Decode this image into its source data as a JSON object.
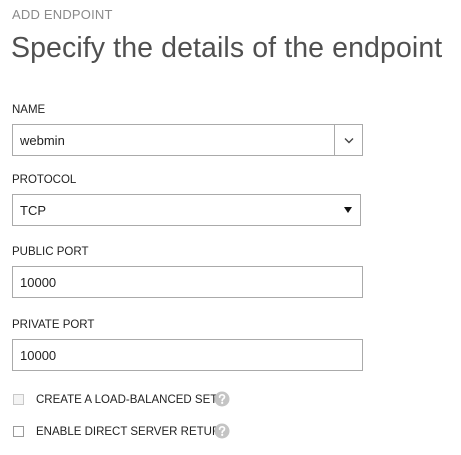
{
  "header": {
    "subtitle": "ADD ENDPOINT",
    "title": "Specify the details of the endpoint"
  },
  "form": {
    "name": {
      "label": "NAME",
      "value": "webmin"
    },
    "protocol": {
      "label": "PROTOCOL",
      "value": "TCP"
    },
    "public_port": {
      "label": "PUBLIC PORT",
      "value": "10000"
    },
    "private_port": {
      "label": "PRIVATE PORT",
      "value": "10000"
    },
    "load_balanced": {
      "label": "CREATE A LOAD-BALANCED SET",
      "checked": false,
      "disabled": true
    },
    "direct_server_return": {
      "label": "ENABLE DIRECT SERVER RETURN",
      "checked": false,
      "disabled": false
    }
  },
  "icons": {
    "combo": "chevron-down-icon",
    "select": "triangle-down-icon",
    "help": "question-mark-icon"
  },
  "colors": {
    "border": "#aaaaaa",
    "subtitle": "#8a8a8a",
    "title": "#505050",
    "help_icon": "#c4c4c4"
  }
}
